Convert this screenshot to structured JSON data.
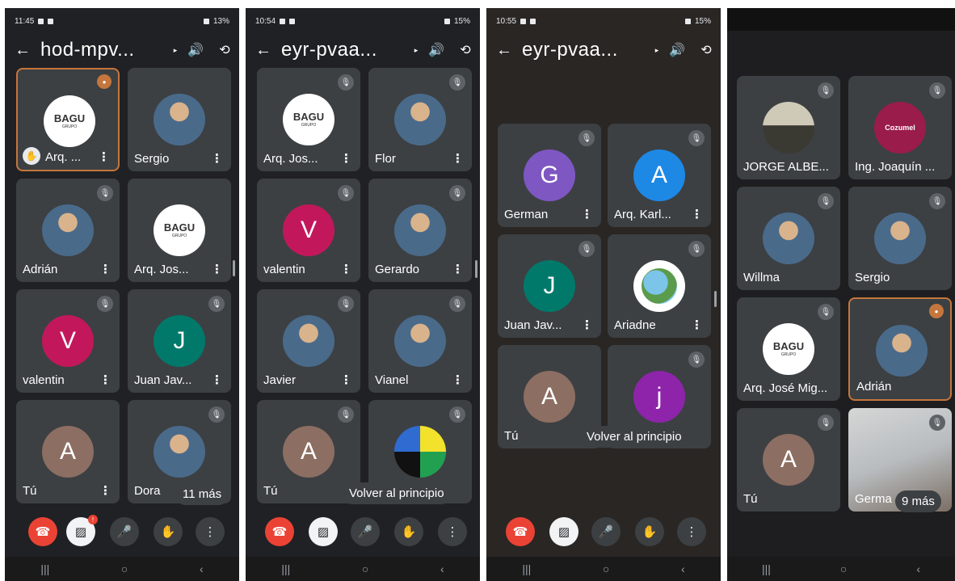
{
  "screens": [
    {
      "time": "11:45",
      "battery": "13%",
      "title": "hod-mpv...",
      "tiles": [
        "Arq. ...",
        "Sergio",
        "Adrián",
        "Arq. Jos...",
        "valentin",
        "Juan Jav...",
        "Tú",
        "Dora"
      ],
      "more": "11 más"
    },
    {
      "time": "10:54",
      "battery": "15%",
      "title": "eyr-pvaa...",
      "tiles": [
        "Arq. Jos...",
        "Flor",
        "valentin",
        "Gerardo",
        "Javier",
        "Vianel",
        "Tú",
        ""
      ],
      "back_to_top": "Volver al principio"
    },
    {
      "time": "10:55",
      "battery": "15%",
      "title": "eyr-pvaa...",
      "tiles": [
        "German",
        "Arq. Karl...",
        "Juan Jav...",
        "Ariadne",
        "Tú",
        ""
      ],
      "back_to_top": "Volver al principio"
    },
    {
      "tiles": [
        "JORGE ALBE...",
        "Ing. Joaquín ...",
        "Willma",
        "Sergio",
        "Arq. José Mig...",
        "Adrián",
        "Tú",
        "Germa"
      ],
      "more": "9 más"
    }
  ],
  "initials": {
    "valentin": "V",
    "juan": "J",
    "tu": "A",
    "german": "G",
    "karl": "A",
    "lower_j": "j"
  },
  "logo_text": "BAGU",
  "logo_sub": "GRUPO",
  "cozumel": "Cozumel",
  "icons": {
    "back": "←",
    "caret": "▸",
    "speaker": "🔊",
    "flip": "⟲",
    "kebab": "⋮",
    "mute": "🎙",
    "hand": "✋",
    "end": "☎",
    "cam": "▨",
    "mic": "🎤",
    "more": "⋮",
    "nav_recent": "|||",
    "nav_home": "○",
    "nav_back": "‹"
  },
  "colors": {
    "bg": "#202124",
    "tile": "#3c4043",
    "end": "#ea4335",
    "speaking": "#c5763c",
    "valentin": "#c2185b",
    "juan": "#00796b",
    "tu": "#8d6e63",
    "german": "#7e57c2",
    "karl": "#1e88e5",
    "lower_j": "#8e24aa"
  }
}
